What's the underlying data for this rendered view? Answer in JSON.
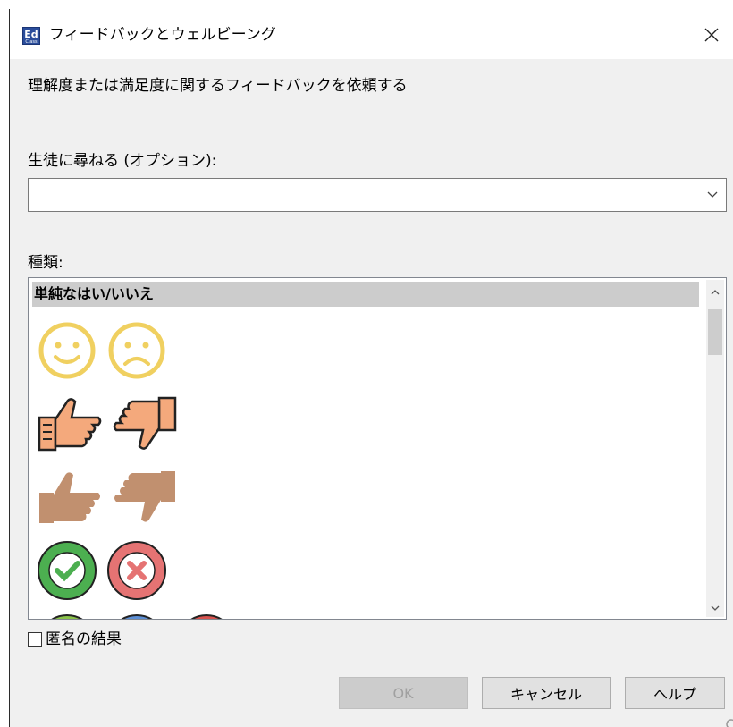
{
  "window": {
    "title": "フィードバックとウェルビーング",
    "app_icon_text": "Ed",
    "app_icon_subtext": "Class"
  },
  "prompt": "理解度または満足度に関するフィードバックを依頼する",
  "ask_students": {
    "label": "生徒に尋ねる (オプション):",
    "value": ""
  },
  "type_list": {
    "label": "種類:",
    "selected_header": "単純なはい/いいえ",
    "rows": [
      [
        "smiley-happy-icon",
        "smiley-sad-icon"
      ],
      [
        "thumbs-up-light-icon",
        "thumbs-down-light-icon"
      ],
      [
        "thumbs-up-dark-icon",
        "thumbs-down-dark-icon"
      ],
      [
        "check-circle-icon",
        "cross-circle-icon"
      ]
    ]
  },
  "anonymous": {
    "label": "匿名の結果",
    "checked": false
  },
  "buttons": {
    "ok": "OK",
    "cancel": "キャンセル",
    "help": "ヘルプ"
  },
  "colors": {
    "smiley_yellow": "#f0d060",
    "light_skin": "#f4a97c",
    "dark_skin": "#c1906f",
    "check_green": "#4caf50",
    "cross_red": "#e57373",
    "list_header_bg": "#cccccc"
  }
}
